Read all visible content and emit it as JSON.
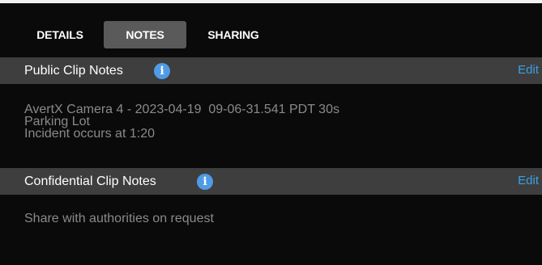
{
  "tabs": {
    "details": "DETAILS",
    "notes": "NOTES",
    "sharing": "SHARING"
  },
  "public_notes": {
    "title": "Public Clip Notes",
    "edit": "Edit",
    "lines": [
      "AvertX Camera 4 - 2023-04-19  09-06-31.541 PDT 30s",
      "Parking Lot",
      "Incident occurs at 1:20"
    ]
  },
  "confidential_notes": {
    "title": "Confidential Clip Notes",
    "edit": "Edit",
    "lines": [
      "Share with authorities on request"
    ]
  },
  "icons": {
    "info": "info-icon",
    "info_glyph": "i"
  },
  "colors": {
    "background": "#0a0a0a",
    "section_header": "#3e3e3e",
    "active_tab": "#5a5a5a",
    "link": "#3aa0e8",
    "info_icon": "#4f9be6",
    "note_text": "#8a8a8a"
  }
}
